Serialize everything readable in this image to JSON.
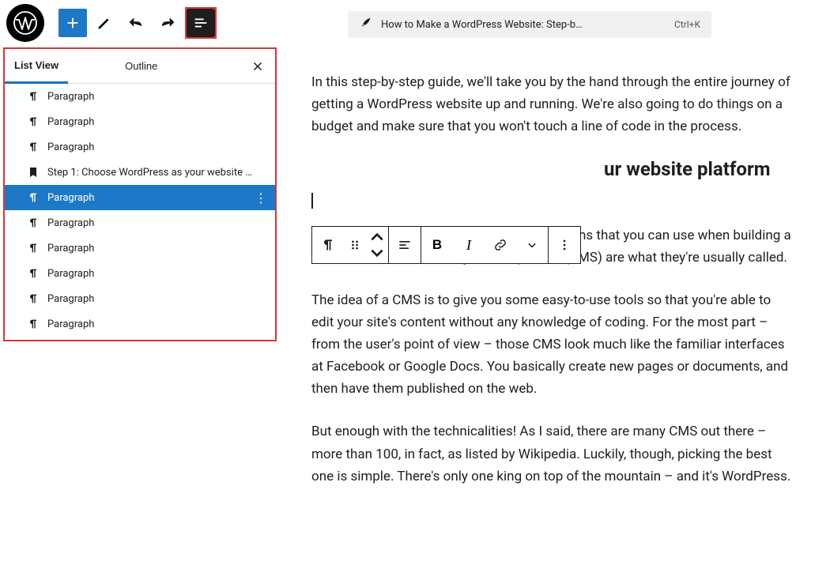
{
  "topbar": {
    "title": "How to Make a WordPress Website: Step-b…",
    "shortcut": "Ctrl+K"
  },
  "sidebar": {
    "tabs": {
      "list_view": "List View",
      "outline": "Outline"
    },
    "items": [
      {
        "type": "paragraph",
        "label": "Paragraph"
      },
      {
        "type": "paragraph",
        "label": "Paragraph"
      },
      {
        "type": "paragraph",
        "label": "Paragraph"
      },
      {
        "type": "heading",
        "label": "Step 1: Choose WordPress as your website …"
      },
      {
        "type": "paragraph",
        "label": "Paragraph",
        "selected": true
      },
      {
        "type": "paragraph",
        "label": "Paragraph"
      },
      {
        "type": "paragraph",
        "label": "Paragraph"
      },
      {
        "type": "paragraph",
        "label": "Paragraph"
      },
      {
        "type": "paragraph",
        "label": "Paragraph"
      },
      {
        "type": "paragraph",
        "label": "Paragraph"
      }
    ]
  },
  "editor": {
    "p1": "In this step-by-step guide, we'll take you by the hand through the entire journey of getting a WordPress website up and running. We're also going to do things on a budget and make sure that you won't touch a line of code in the process.",
    "h2_partial": "ur website platform",
    "p2": "Truth be told, there are many website platforms that you can use when building a new site – Content Management Systems (CMS) are what they're usually called.",
    "p3": "The idea of a CMS is to give you some easy-to-use tools so that you're able to edit your site's content without any knowledge of coding. For the most part – from the user's point of view – those CMS look much like the familiar interfaces at Facebook or Google Docs. You basically create new pages or documents, and then have them published on the web.",
    "p4": "But enough with the technicalities! As I said, there are many CMS out there – more than 100, in fact, as listed by Wikipedia. Luckily, though, picking the best one is simple. There's only one king on top of the mountain – and it's WordPress."
  },
  "toolbar_labels": {
    "bold": "B",
    "italic": "I"
  }
}
